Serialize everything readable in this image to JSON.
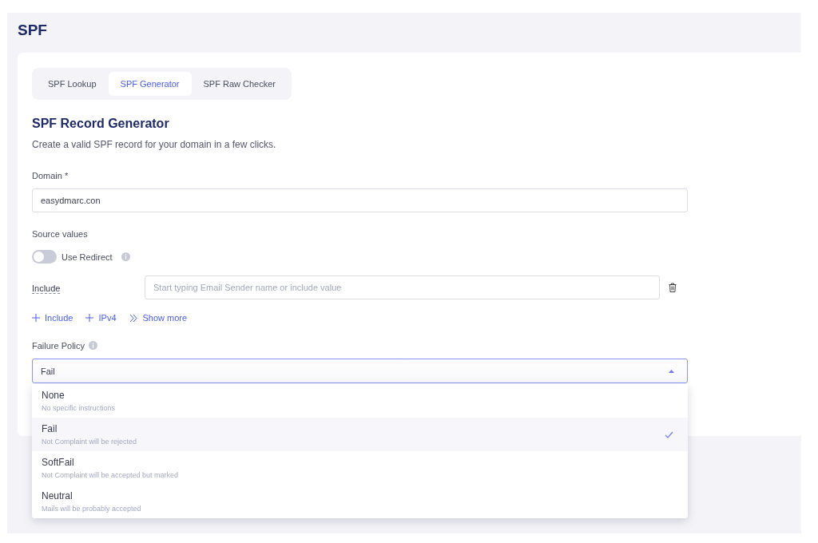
{
  "page": {
    "title": "SPF"
  },
  "tabs": [
    {
      "label": "SPF Lookup",
      "selected": false
    },
    {
      "label": "SPF Generator",
      "selected": true
    },
    {
      "label": "SPF Raw Checker",
      "selected": false
    }
  ],
  "generator": {
    "title": "SPF Record Generator",
    "description": "Create a valid SPF record for your domain in a few clicks.",
    "domain": {
      "label": "Domain *",
      "value": "easydmarc.con"
    },
    "source_values": {
      "label": "Source values"
    },
    "use_redirect": {
      "label": "Use Redirect",
      "on": false
    },
    "include": {
      "label": "Include",
      "placeholder": "Start typing Email Sender name or include value"
    },
    "add_links": [
      {
        "kind": "add",
        "label": "Include"
      },
      {
        "kind": "add",
        "label": "IPv4"
      },
      {
        "kind": "more",
        "label": "Show more"
      }
    ],
    "failure_policy": {
      "label": "Failure Policy",
      "value": "Fail",
      "expanded": true,
      "options": [
        {
          "label": "None",
          "description": "No specific instructions",
          "selected": false
        },
        {
          "label": "Fail",
          "description": "Not Complaint will be rejected",
          "selected": true
        },
        {
          "label": "SoftFail",
          "description": "Not Complaint will be accepted but marked",
          "selected": false
        },
        {
          "label": "Neutral",
          "description": "Mails will be probably accepted",
          "selected": false
        }
      ]
    }
  }
}
